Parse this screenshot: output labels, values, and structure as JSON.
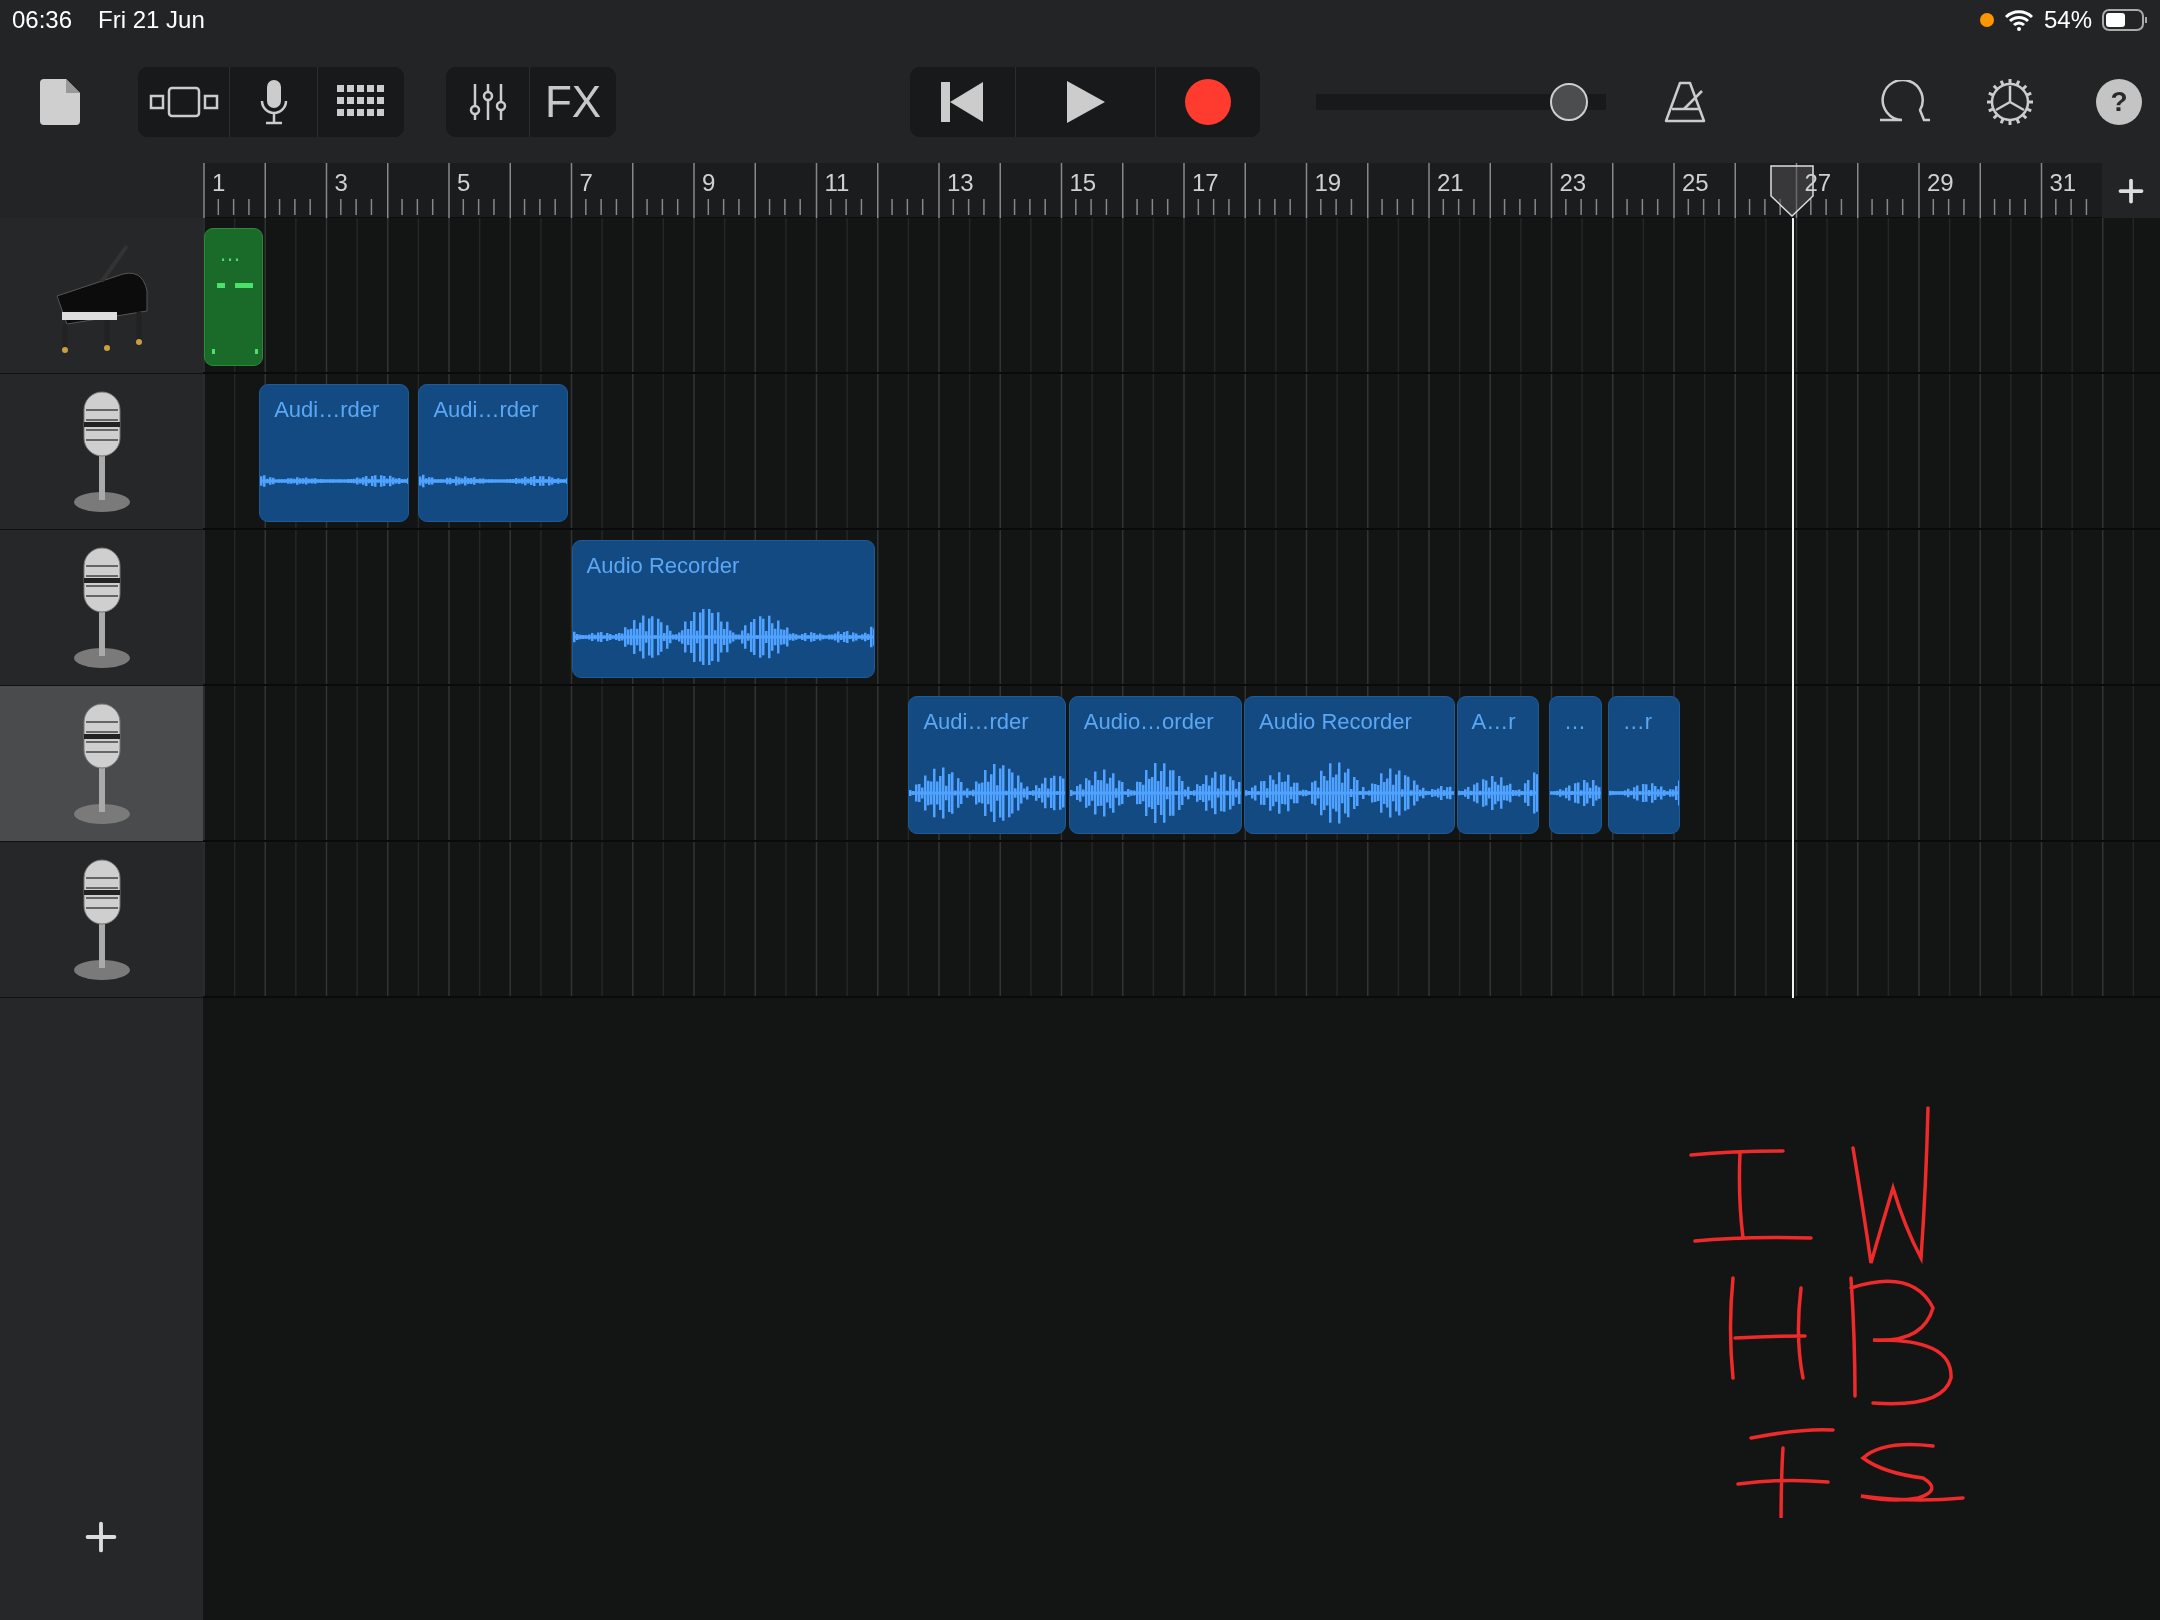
{
  "status_bar": {
    "time": "06:36",
    "date": "Fri 21 Jun",
    "battery": "54%"
  },
  "toolbar": {
    "fx_label": "FX",
    "volume": {
      "level": 0.93
    },
    "help_label": "?"
  },
  "ruler": {
    "labels": [
      "1",
      "3",
      "5",
      "7",
      "9",
      "11",
      "13",
      "15",
      "17",
      "19",
      "21",
      "23",
      "25",
      "27",
      "29",
      "31"
    ]
  },
  "tracks": [
    {
      "kind": "piano",
      "selected": false,
      "regions": [
        {
          "kind": "midi",
          "title": "…"
        }
      ]
    },
    {
      "kind": "microphone",
      "selected": false,
      "regions": [
        {
          "kind": "audio",
          "title": "Audi…rder"
        },
        {
          "kind": "audio",
          "title": "Audi…rder"
        }
      ]
    },
    {
      "kind": "microphone",
      "selected": false,
      "regions": [
        {
          "kind": "audio",
          "title": "Audio Recorder"
        }
      ]
    },
    {
      "kind": "microphone",
      "selected": true,
      "regions": [
        {
          "kind": "audio",
          "title": "Audi…rder"
        },
        {
          "kind": "audio",
          "title": "Audio…order"
        },
        {
          "kind": "audio",
          "title": "Audio Recorder"
        },
        {
          "kind": "audio",
          "title": "A…r"
        },
        {
          "kind": "audio",
          "title": "…"
        },
        {
          "kind": "audio",
          "title": "…r"
        }
      ]
    },
    {
      "kind": "microphone",
      "selected": false
    }
  ]
}
